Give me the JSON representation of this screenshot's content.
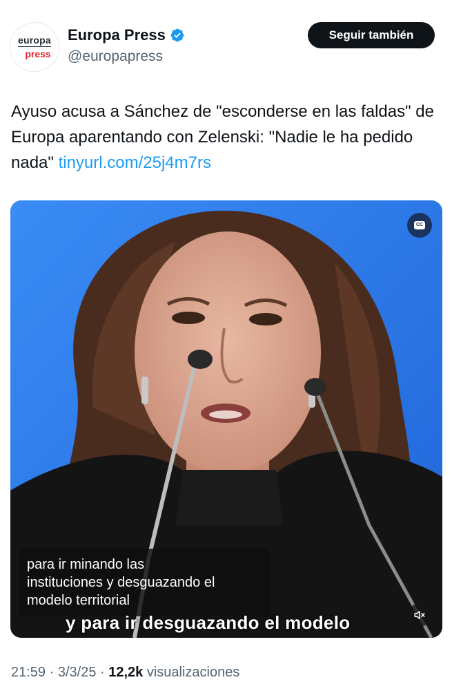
{
  "header": {
    "avatar_top": "europa",
    "avatar_bottom": "press",
    "display_name": "Europa Press",
    "handle": "@europapress",
    "follow_label": "Seguir también"
  },
  "tweet": {
    "text": "Ayuso acusa a Sánchez de \"esconderse en las faldas\" de Europa aparentando con Zelenski: \"Nadie le ha pedido nada\" ",
    "link": "tinyurl.com/25j4m7rs"
  },
  "video": {
    "cc_label": "CC",
    "caption_lines": [
      "para ir minando las",
      "instituciones y desguazando el",
      "modelo territorial"
    ],
    "burned_subtitle": "y para ir desguazando el modelo"
  },
  "meta": {
    "time": "21:59",
    "sep1": " · ",
    "date": "3/3/25",
    "sep2": " · ",
    "views_count": "12,2k",
    "views_label": " visualizaciones"
  },
  "colors": {
    "accent": "#1d9bf0",
    "verified": "#1d9bf0",
    "button_bg": "#0f1419",
    "video_background": "#2c7df0"
  },
  "icons": {
    "verified": "verified-badge-icon",
    "cc": "closed-captions-icon",
    "mute": "muted-speaker-icon"
  }
}
